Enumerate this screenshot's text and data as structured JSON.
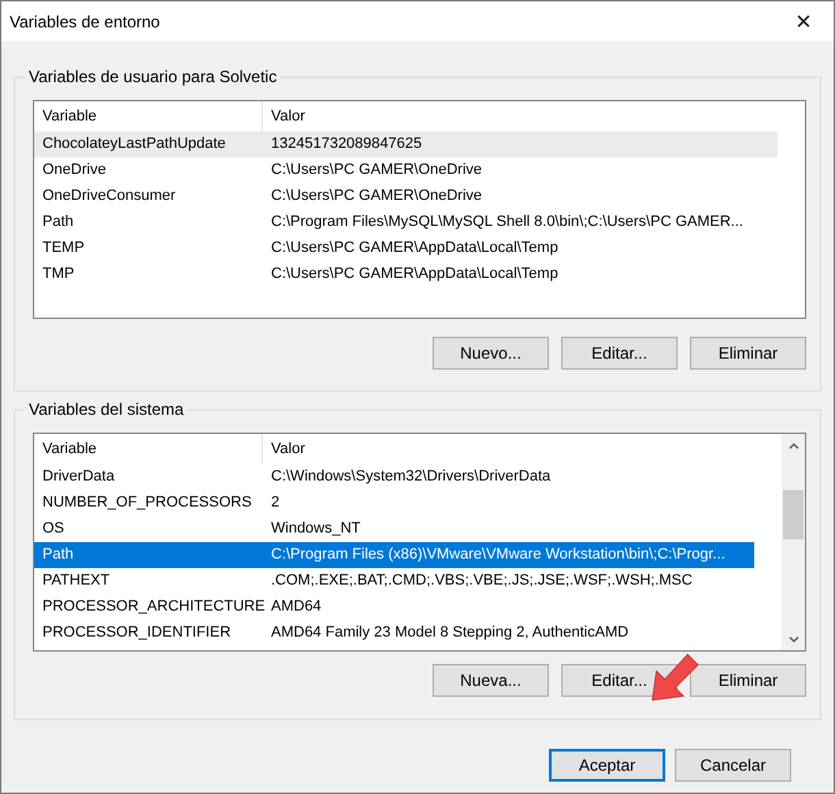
{
  "window": {
    "title": "Variables de entorno",
    "close": "✕"
  },
  "groups": [
    {
      "title": "Variables de usuario para Solvetic",
      "focused": false,
      "scrollbar": false,
      "columns": [
        "Variable",
        "Valor"
      ],
      "rows": [
        {
          "name": "ChocolateyLastPathUpdate",
          "value": "132451732089847625",
          "selected": true
        },
        {
          "name": "OneDrive",
          "value": "C:\\Users\\PC GAMER\\OneDrive",
          "selected": false
        },
        {
          "name": "OneDriveConsumer",
          "value": "C:\\Users\\PC GAMER\\OneDrive",
          "selected": false
        },
        {
          "name": "Path",
          "value": "C:\\Program Files\\MySQL\\MySQL Shell 8.0\\bin\\;C:\\Users\\PC GAMER...",
          "selected": false
        },
        {
          "name": "TEMP",
          "value": "C:\\Users\\PC GAMER\\AppData\\Local\\Temp",
          "selected": false
        },
        {
          "name": "TMP",
          "value": "C:\\Users\\PC GAMER\\AppData\\Local\\Temp",
          "selected": false
        }
      ],
      "buttons": [
        "Nuevo...",
        "Editar...",
        "Eliminar"
      ]
    },
    {
      "title": "Variables del sistema",
      "focused": true,
      "scrollbar": true,
      "columns": [
        "Variable",
        "Valor"
      ],
      "rows": [
        {
          "name": "DriverData",
          "value": "C:\\Windows\\System32\\Drivers\\DriverData",
          "selected": false
        },
        {
          "name": "NUMBER_OF_PROCESSORS",
          "value": "2",
          "selected": false
        },
        {
          "name": "OS",
          "value": "Windows_NT",
          "selected": false
        },
        {
          "name": "Path",
          "value": "C:\\Program Files (x86)\\VMware\\VMware Workstation\\bin\\;C:\\Progr...",
          "selected": true
        },
        {
          "name": "PATHEXT",
          "value": ".COM;.EXE;.BAT;.CMD;.VBS;.VBE;.JS;.JSE;.WSF;.WSH;.MSC",
          "selected": false
        },
        {
          "name": "PROCESSOR_ARCHITECTURE",
          "value": "AMD64",
          "selected": false
        },
        {
          "name": "PROCESSOR_IDENTIFIER",
          "value": "AMD64 Family 23 Model 8 Stepping 2, AuthenticAMD",
          "selected": false
        }
      ],
      "buttons": [
        "Nueva...",
        "Editar...",
        "Eliminar"
      ]
    }
  ],
  "footer": [
    {
      "label": "Aceptar",
      "default": true
    },
    {
      "label": "Cancelar",
      "default": false
    }
  ]
}
